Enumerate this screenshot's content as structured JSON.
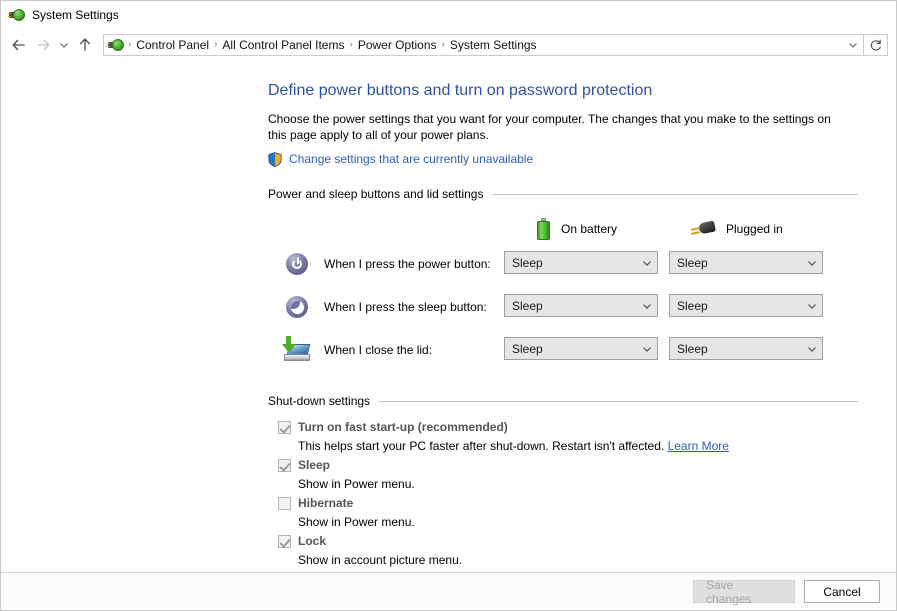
{
  "window": {
    "title": "System Settings",
    "app_icon": "power-options-icon"
  },
  "navbar": {
    "back_icon": "back-arrow-icon",
    "forward_icon": "forward-arrow-icon",
    "recent_icon": "chevron-down-icon",
    "up_icon": "up-arrow-icon",
    "refresh_icon": "refresh-icon",
    "dropdown_icon": "chevron-down-icon",
    "breadcrumb_icon": "power-options-icon",
    "breadcrumbs": [
      "Control Panel",
      "All Control Panel Items",
      "Power Options",
      "System Settings"
    ],
    "separator": "›"
  },
  "main": {
    "heading": "Define power buttons and turn on password protection",
    "description": "Choose the power settings that you want for your computer. The changes that you make to the settings on this page apply to all of your power plans.",
    "uac_link": "Change settings that are currently unavailable",
    "uac_icon": "uac-shield-icon",
    "sections": {
      "power_lid": {
        "title": "Power and sleep buttons and lid settings",
        "columns": [
          {
            "label": "On battery",
            "icon": "battery-icon"
          },
          {
            "label": "Plugged in",
            "icon": "power-plug-icon"
          }
        ],
        "rows": [
          {
            "icon": "power-button-icon",
            "label": "When I press the power button:",
            "on_battery": "Sleep",
            "plugged_in": "Sleep"
          },
          {
            "icon": "sleep-button-icon",
            "label": "When I press the sleep button:",
            "on_battery": "Sleep",
            "plugged_in": "Sleep"
          },
          {
            "icon": "laptop-lid-icon",
            "label": "When I close the lid:",
            "on_battery": "Sleep",
            "plugged_in": "Sleep"
          }
        ]
      },
      "shutdown": {
        "title": "Shut-down settings",
        "items": [
          {
            "label": "Turn on fast start-up (recommended)",
            "checked": true,
            "description": "This helps start your PC faster after shut-down. Restart isn't affected.",
            "link": "Learn More"
          },
          {
            "label": "Sleep",
            "checked": true,
            "description": "Show in Power menu.",
            "link": ""
          },
          {
            "label": "Hibernate",
            "checked": false,
            "description": "Show in Power menu.",
            "link": ""
          },
          {
            "label": "Lock",
            "checked": true,
            "description": "Show in account picture menu.",
            "link": ""
          }
        ]
      }
    }
  },
  "footer": {
    "save_label": "Save changes",
    "save_enabled": false,
    "cancel_label": "Cancel"
  },
  "colors": {
    "heading": "#2d53a0",
    "link": "#2a5fb4",
    "battery_green": "#52bf35",
    "disabled_text": "#a8a8a8",
    "combo_bg": "#e6e6e6"
  }
}
